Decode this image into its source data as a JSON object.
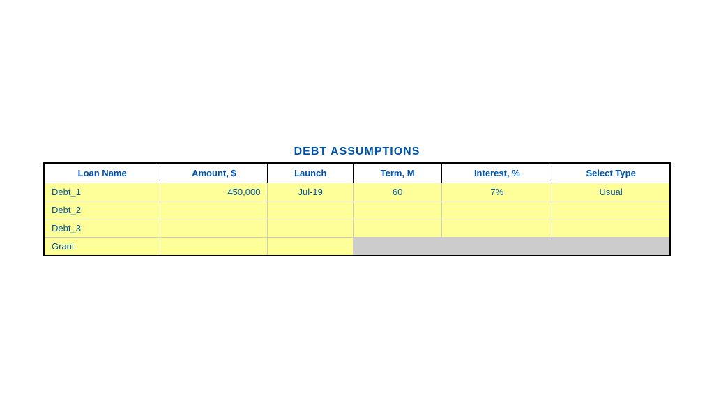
{
  "title": "DEBT ASSUMPTIONS",
  "columns": [
    {
      "key": "loan_name",
      "label": "Loan Name"
    },
    {
      "key": "amount",
      "label": "Amount, $"
    },
    {
      "key": "launch",
      "label": "Launch"
    },
    {
      "key": "term",
      "label": "Term, M"
    },
    {
      "key": "interest",
      "label": "Interest, %"
    },
    {
      "key": "select_type",
      "label": "Select Type"
    }
  ],
  "rows": [
    {
      "loan_name": "Debt_1",
      "amount": "450,000",
      "launch": "Jul-19",
      "term": "60",
      "interest": "7%",
      "select_type": "Usual",
      "type": "full_yellow"
    },
    {
      "loan_name": "Debt_2",
      "amount": "",
      "launch": "",
      "term": "",
      "interest": "",
      "select_type": "",
      "type": "full_yellow"
    },
    {
      "loan_name": "Debt_3",
      "amount": "",
      "launch": "",
      "term": "",
      "interest": "",
      "select_type": "",
      "type": "full_yellow"
    },
    {
      "loan_name": "Grant",
      "amount": "",
      "launch": "",
      "term": "",
      "interest": "",
      "select_type": "",
      "type": "partial_gray"
    }
  ]
}
